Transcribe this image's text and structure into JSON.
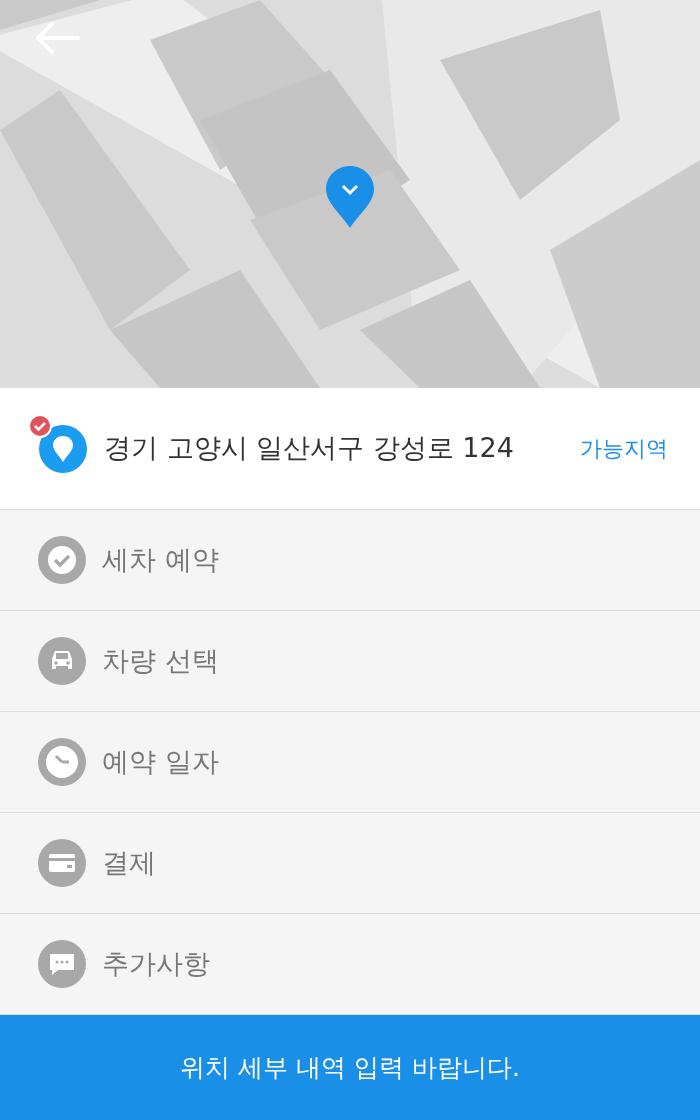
{
  "address": {
    "text": "경기 고양시 일산서구 강성로 124",
    "checked": true,
    "link": "가능지역"
  },
  "menu": [
    {
      "kind": "check",
      "label": "세차 예약"
    },
    {
      "kind": "car",
      "label": "차량 선택"
    },
    {
      "kind": "clock",
      "label": "예약 일자"
    },
    {
      "kind": "card",
      "label": "결제"
    },
    {
      "kind": "chat",
      "label": "추가사항"
    }
  ],
  "submit": "위치 세부 내역 입력 바랍니다."
}
